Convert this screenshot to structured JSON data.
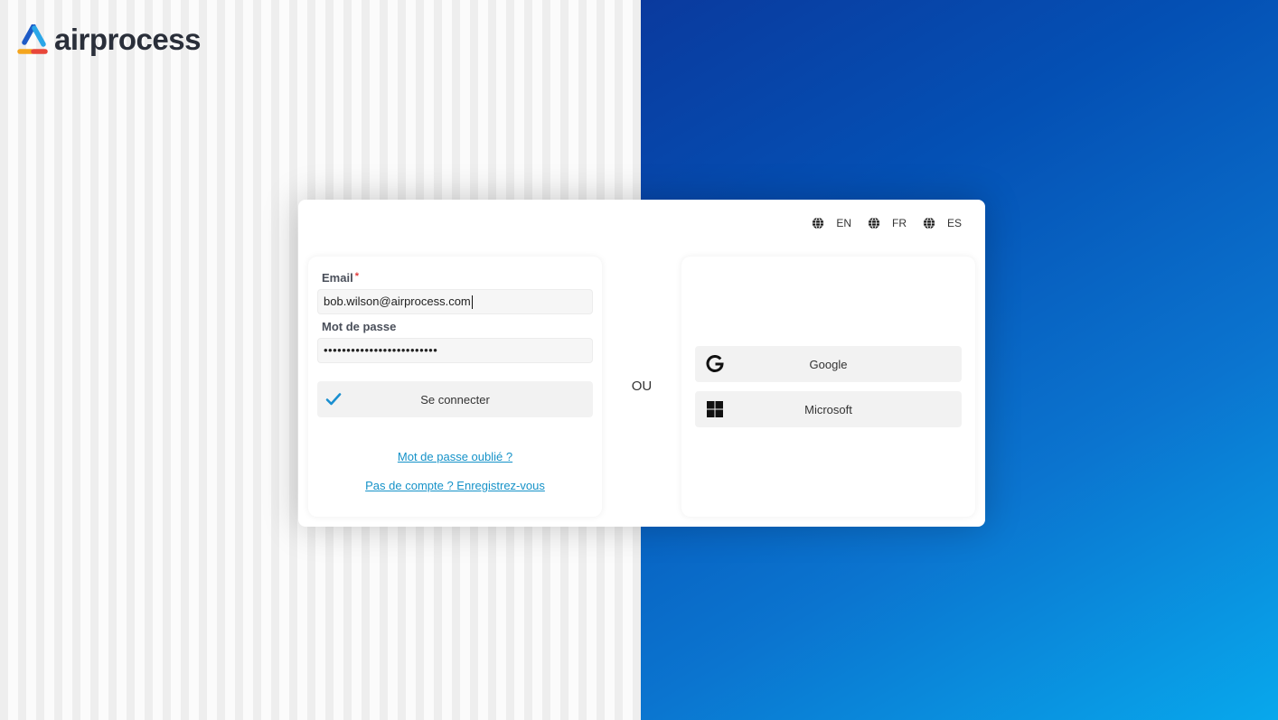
{
  "brand": {
    "name": "airprocess"
  },
  "languages": [
    {
      "code": "EN"
    },
    {
      "code": "FR"
    },
    {
      "code": "ES"
    }
  ],
  "form": {
    "email_label": "Email",
    "required_mark": "*",
    "email_value": "bob.wilson@airprocess.com",
    "password_label": "Mot de passe",
    "password_value": "•••••••••••••••••••••••••",
    "login_button": "Se connecter",
    "forgot_link": "Mot de passe oublié ?",
    "register_link": "Pas de compte ? Enregistrez-vous"
  },
  "separator": "OU",
  "sso": {
    "google_label": "Google",
    "microsoft_label": "Microsoft"
  },
  "colors": {
    "link": "#1592c8",
    "check": "#1a8fd0",
    "required": "#e23b3b",
    "gradient_start": "#0a3a9e",
    "gradient_end": "#08a8ec"
  },
  "icons": {
    "logo": "airprocess-logo-icon",
    "language": "globe-icon",
    "login": "checkmark-icon",
    "google": "google-icon",
    "microsoft": "microsoft-icon"
  }
}
